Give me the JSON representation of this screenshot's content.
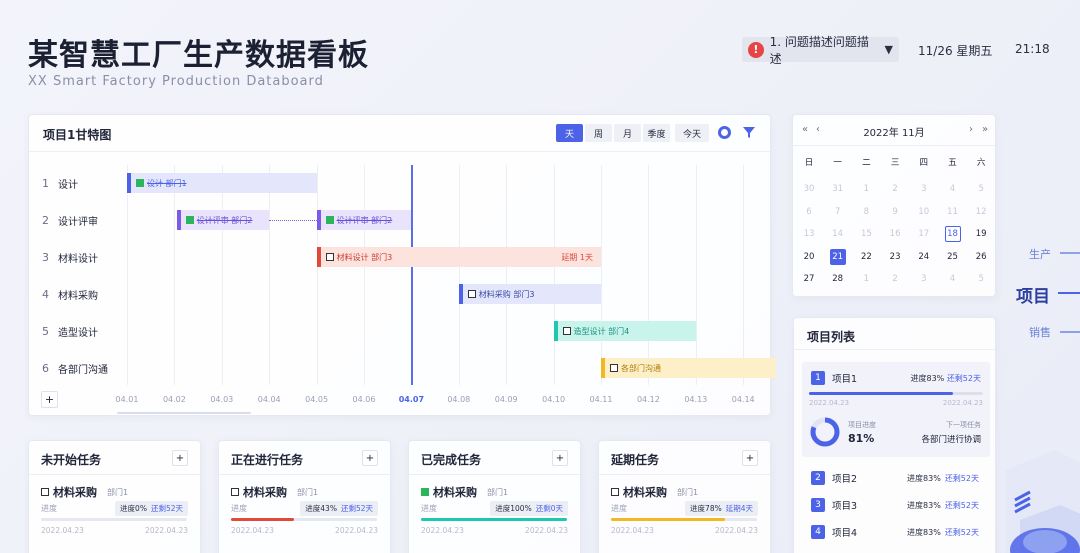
{
  "header": {
    "title": "某智慧工厂生产数据看板",
    "subtitle": "XX Smart Factory Production Databoard",
    "issue_text": "1. 问题描述问题描述",
    "date": "11/26 星期五",
    "time": "21:18"
  },
  "gantt": {
    "title": "项目1甘特图",
    "view_tabs": [
      "天",
      "周",
      "月",
      "季度"
    ],
    "active_tab": "天",
    "today_label": "今天",
    "rows": [
      {
        "num": "1",
        "label": "设计"
      },
      {
        "num": "2",
        "label": "设计评审"
      },
      {
        "num": "3",
        "label": "材料设计"
      },
      {
        "num": "4",
        "label": "材料采购"
      },
      {
        "num": "5",
        "label": "造型设计"
      },
      {
        "num": "6",
        "label": "各部门沟通"
      }
    ],
    "dates": [
      "04.01",
      "04.02",
      "04.03",
      "04.04",
      "04.05",
      "04.06",
      "04.07",
      "04.08",
      "04.09",
      "04.10",
      "04.11",
      "04.12",
      "04.13",
      "04.14"
    ],
    "today_date": "04.07",
    "bars": [
      {
        "text": "设计  部门1",
        "done": true
      },
      {
        "text": "设计评审  部门2",
        "done": true
      },
      {
        "text": "设计评审  部门2",
        "done": true
      },
      {
        "text": "材料设计  部门3",
        "done": false,
        "delay": "延期 1天"
      },
      {
        "text": "材料采购  部门3",
        "done": false
      },
      {
        "text": "造型设计  部门4",
        "done": false
      },
      {
        "text": "各部门沟通",
        "done": false
      }
    ],
    "colors": {
      "accent": "#4c63e8",
      "red": "#e14a3a",
      "teal": "#1fc7b0",
      "yellow": "#f2b822"
    }
  },
  "tasks": [
    {
      "title": "未开始任务",
      "name": "材料采购",
      "dept": "部门1",
      "progress_label": "进度",
      "badge": "进度0%",
      "remain": "还剩52天",
      "progress": 0,
      "start": "2022.04.23",
      "end": "2022.04.23",
      "done": false
    },
    {
      "title": "正在进行任务",
      "name": "材料采购",
      "dept": "部门1",
      "progress_label": "进度",
      "badge": "进度43%",
      "remain": "还剩52天",
      "progress": 43,
      "start": "2022.04.23",
      "end": "2022.04.23",
      "done": false
    },
    {
      "title": "已完成任务",
      "name": "材料采购",
      "dept": "部门1",
      "progress_label": "进度",
      "badge": "进度100%",
      "remain": "还剩0天",
      "progress": 100,
      "start": "2022.04.23",
      "end": "2022.04.23",
      "done": true
    },
    {
      "title": "延期任务",
      "name": "材料采购",
      "dept": "部门1",
      "progress_label": "进度",
      "badge": "进度78%",
      "remain": "延期4天",
      "progress": 78,
      "start": "2022.04.23",
      "end": "2022.04.23",
      "done": false
    }
  ],
  "calendar": {
    "prev_year": "«",
    "prev_month": "‹",
    "next_month": "›",
    "next_year": "»",
    "title": "2022年  11月",
    "weekdays": [
      "日",
      "一",
      "二",
      "三",
      "四",
      "五",
      "六"
    ],
    "weeks": [
      [
        "30",
        "31",
        "1",
        "2",
        "3",
        "4",
        "5"
      ],
      [
        "6",
        "7",
        "8",
        "9",
        "10",
        "11",
        "12"
      ],
      [
        "13",
        "14",
        "15",
        "16",
        "17",
        "18",
        "19"
      ],
      [
        "20",
        "21",
        "22",
        "23",
        "24",
        "25",
        "26"
      ],
      [
        "27",
        "28",
        "1",
        "2",
        "3",
        "4",
        "5"
      ]
    ],
    "selected": "21",
    "today": "18"
  },
  "projects": {
    "title": "项目列表",
    "items": [
      {
        "num": "1",
        "name": "项目1",
        "status": "进度83%",
        "remain": "还剩52天"
      },
      {
        "num": "2",
        "name": "项目2",
        "status": "进度83%",
        "remain": "还剩52天"
      },
      {
        "num": "3",
        "name": "项目3",
        "status": "进度83%",
        "remain": "还剩52天"
      },
      {
        "num": "4",
        "name": "项目4",
        "status": "进度83%",
        "remain": "还剩52天"
      }
    ],
    "featured": {
      "progress": 83,
      "start": "2022.04.23",
      "end": "2022.04.23",
      "progress_caption": "项目进度",
      "progress_value": "81%",
      "next_caption": "下一项任务",
      "next_value": "各部门进行协调"
    }
  },
  "side_nav": [
    "生产",
    "项目",
    "销售"
  ],
  "side_active": "项目"
}
